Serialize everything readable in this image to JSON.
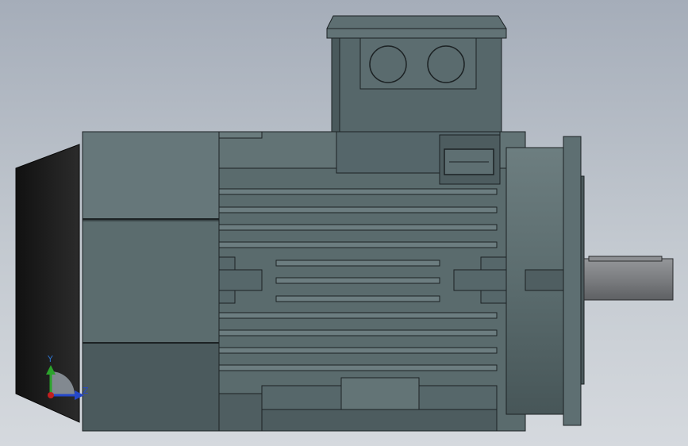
{
  "triad": {
    "x_label": "",
    "y_label": "Y",
    "z_label": "Z",
    "colors": {
      "x": "#c21f1f",
      "y": "#2ca32c",
      "z": "#2548c9"
    }
  },
  "colors": {
    "background_top": "#a5adb9",
    "background_bottom": "#d5d9de",
    "body": "#56676a",
    "body_light": "#68797b",
    "body_dark": "#46555a",
    "fan_cover": "#1a1a1a",
    "shaft": "#7d7f82",
    "edge": "#1c2224"
  }
}
